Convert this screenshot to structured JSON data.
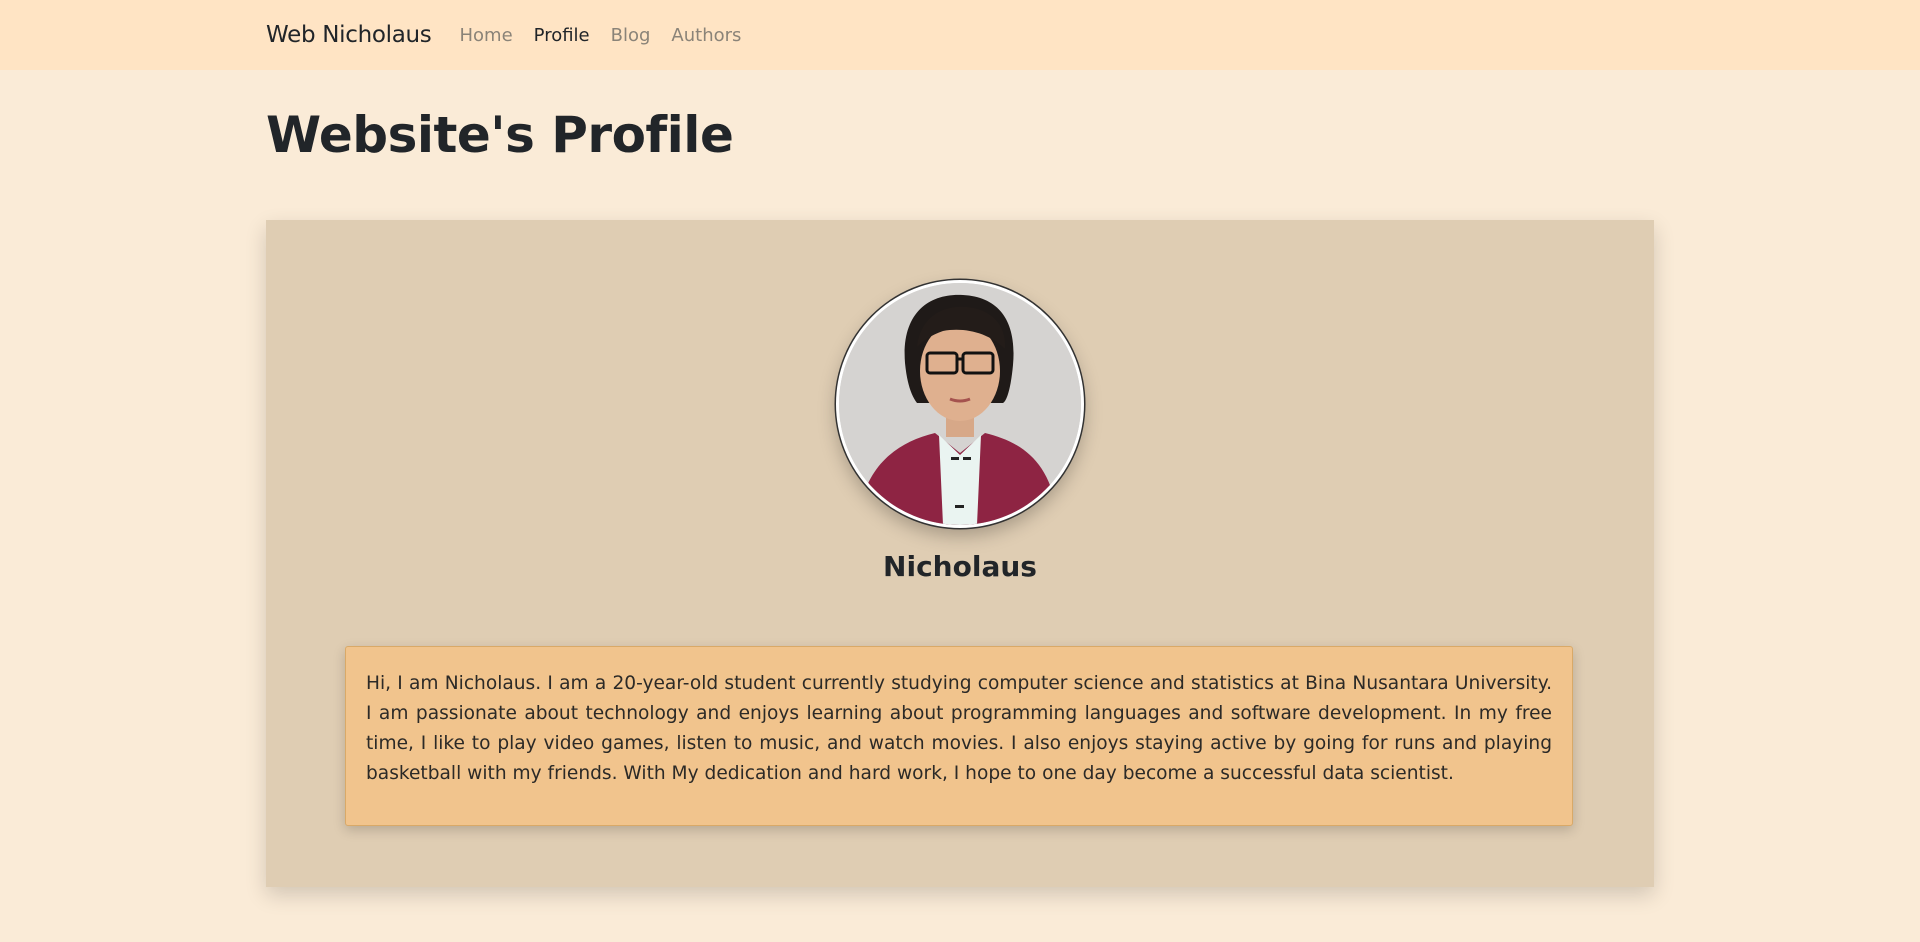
{
  "navbar": {
    "brand": "Web Nicholaus",
    "links": [
      {
        "label": "Home",
        "active": false
      },
      {
        "label": "Profile",
        "active": true
      },
      {
        "label": "Blog",
        "active": false
      },
      {
        "label": "Authors",
        "active": false
      }
    ]
  },
  "page": {
    "title": "Website's Profile"
  },
  "profile": {
    "name": "Nicholaus",
    "bio": "Hi, I am Nicholaus. I am a 20-year-old student currently studying computer science and statistics at Bina Nusantara University. I am passionate about technology and enjoys learning about programming languages and software development. In my free time, I like to play video games, listen to music, and watch movies. I also enjoys staying active by going for runs and playing basketball with my friends. With My dedication and hard work, I hope to one day become a successful data scientist."
  },
  "colors": {
    "page_background": "#faebd7",
    "navbar_background": "#ffe4c4",
    "card_background": "#dfcdb3",
    "bio_background": "#f1c48d"
  }
}
